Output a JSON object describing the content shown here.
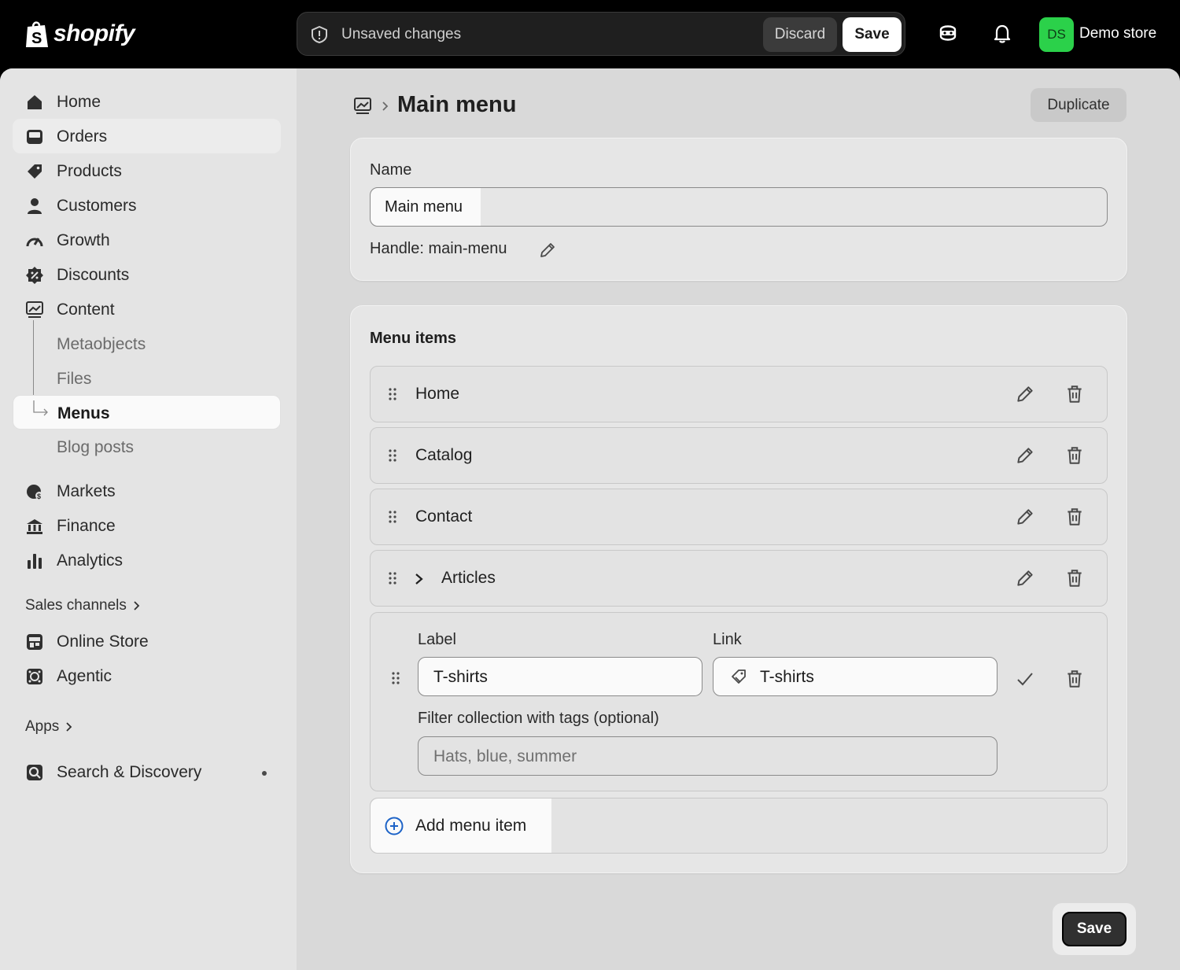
{
  "brand": {
    "name": "shopify"
  },
  "topbar": {
    "unsaved_text": "Unsaved changes",
    "discard_label": "Discard",
    "save_label": "Save",
    "avatar_initials": "DS",
    "store_name": "Demo store",
    "avatar_color": "#2bd14a"
  },
  "sidebar": {
    "items": [
      {
        "label": "Home",
        "icon": "home-icon"
      },
      {
        "label": "Orders",
        "icon": "inbox-icon"
      },
      {
        "label": "Products",
        "icon": "tag-icon"
      },
      {
        "label": "Customers",
        "icon": "person-icon"
      },
      {
        "label": "Growth",
        "icon": "gauge-icon"
      },
      {
        "label": "Discounts",
        "icon": "discount-icon"
      },
      {
        "label": "Content",
        "icon": "image-icon"
      },
      {
        "label": "Metaobjects"
      },
      {
        "label": "Files"
      },
      {
        "label": "Menus"
      },
      {
        "label": "Blog posts"
      },
      {
        "label": "Markets",
        "icon": "globe-icon"
      },
      {
        "label": "Finance",
        "icon": "bank-icon"
      },
      {
        "label": "Analytics",
        "icon": "bar-chart-icon"
      }
    ],
    "sales_channels_label": "Sales channels",
    "channels": [
      {
        "label": "Online Store",
        "icon": "store-icon"
      },
      {
        "label": "Agentic",
        "icon": "agent-icon"
      }
    ],
    "apps_label": "Apps",
    "apps": [
      {
        "label": "Search & Discovery",
        "icon": "search-app-icon"
      }
    ]
  },
  "page": {
    "title": "Main menu",
    "duplicate_label": "Duplicate"
  },
  "name_card": {
    "name_label": "Name",
    "name_value": "Main menu",
    "handle_text": "Handle: main-menu"
  },
  "menu_items": {
    "title": "Menu items",
    "rows": [
      {
        "label": "Home"
      },
      {
        "label": "Catalog"
      },
      {
        "label": "Contact"
      },
      {
        "label": "Articles"
      }
    ],
    "editing": {
      "label_heading": "Label",
      "label_value": "T-shirts",
      "link_heading": "Link",
      "link_value": "T-shirts",
      "filter_heading": "Filter collection with tags (optional)",
      "filter_placeholder": "Hats, blue, summer"
    },
    "add_label": "Add menu item"
  },
  "footer": {
    "save_label": "Save"
  }
}
